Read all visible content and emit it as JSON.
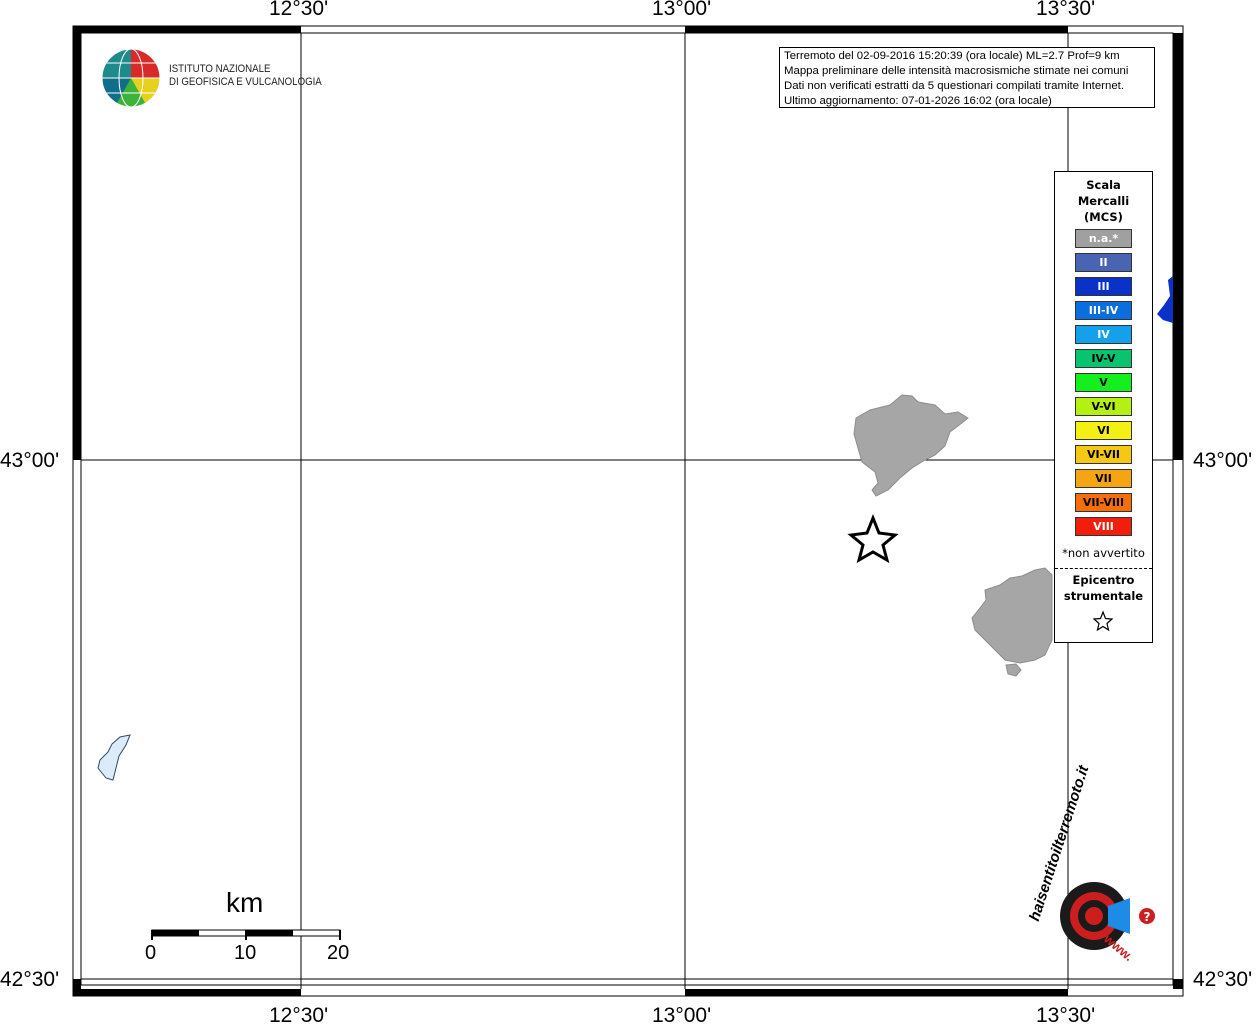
{
  "map": {
    "lon_labels": [
      "12°30'",
      "13°00'",
      "13°30'"
    ],
    "lat_labels": [
      "43°00'",
      "42°30'"
    ]
  },
  "logo": {
    "line1": "ISTITUTO NAZIONALE",
    "line2": "DI GEOFISICA E VULCANOLOGIA"
  },
  "info": {
    "line1": "Terremoto del 02-09-2016 15:20:39 (ora locale) ML=2.7 Prof=9 km",
    "line2": "Mappa preliminare delle intensità macrosismiche stimate nei comuni",
    "line3": "Dati non verificati estratti da 5 questionari compilati tramite Internet.",
    "line4": "Ultimo aggiornamento: 07-01-2026 16:02 (ora locale)"
  },
  "legend": {
    "title1": "Scala",
    "title2": "Mercalli",
    "title3": "(MCS)",
    "items": [
      {
        "label": "n.a.*",
        "color": "#a0a0a0",
        "text": "#ffffff"
      },
      {
        "label": "II",
        "color": "#4a64b4",
        "text": "#ffffff"
      },
      {
        "label": "III",
        "color": "#0a32c8",
        "text": "#ffffff"
      },
      {
        "label": "III-IV",
        "color": "#0a6ede",
        "text": "#ffffff"
      },
      {
        "label": "IV",
        "color": "#14a0eb",
        "text": "#ffffff"
      },
      {
        "label": "IV-V",
        "color": "#0ac36e",
        "text": "#000000"
      },
      {
        "label": "V",
        "color": "#14f01e",
        "text": "#000000"
      },
      {
        "label": "V-VI",
        "color": "#b4f014",
        "text": "#000000"
      },
      {
        "label": "VI",
        "color": "#f5f014",
        "text": "#000000"
      },
      {
        "label": "VI-VII",
        "color": "#f5c814",
        "text": "#000000"
      },
      {
        "label": "VII",
        "color": "#f5a514",
        "text": "#000000"
      },
      {
        "label": "VII-VIII",
        "color": "#f56e0a",
        "text": "#000000"
      },
      {
        "label": "VIII",
        "color": "#f01e0a",
        "text": "#ffffff"
      }
    ],
    "note": "*non avvertito",
    "epicenter1": "Epicentro",
    "epicenter2": "strumentale"
  },
  "scalebar": {
    "unit": "km",
    "ticks": [
      "0",
      "10",
      "20"
    ]
  },
  "brand": {
    "text": "haisentitoilterremoto.it",
    "url": "www."
  }
}
